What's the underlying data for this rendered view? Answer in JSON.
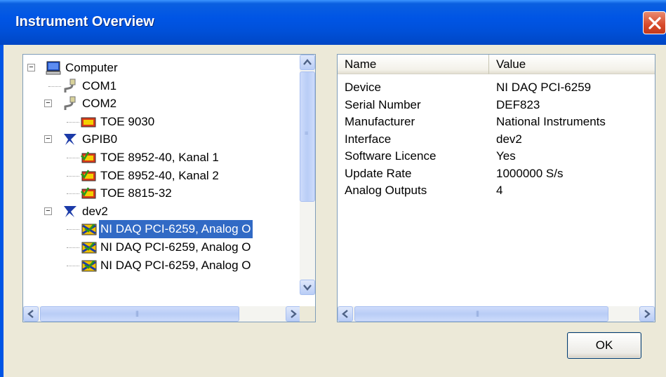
{
  "window": {
    "title": "Instrument Overview"
  },
  "tree": {
    "nodes": [
      {
        "label": "Computer",
        "icon": "computer-icon",
        "expander": "−"
      },
      {
        "label": "COM1",
        "icon": "serial-port-icon"
      },
      {
        "label": "COM2",
        "icon": "serial-port-icon",
        "expander": "−"
      },
      {
        "label": "TOE 9030",
        "icon": "toe-device-icon"
      },
      {
        "label": "GPIB0",
        "icon": "gpib-bus-icon",
        "expander": "−"
      },
      {
        "label": "TOE 8952-40, Kanal 1",
        "icon": "toe-device-check-icon"
      },
      {
        "label": "TOE 8952-40, Kanal 2",
        "icon": "toe-device-check-icon"
      },
      {
        "label": "TOE 8815-32",
        "icon": "toe-device-check-icon"
      },
      {
        "label": "dev2",
        "icon": "ni-device-icon",
        "expander": "−"
      },
      {
        "label": "NI DAQ PCI-6259, Analog O",
        "icon": "ni-daq-icon",
        "selected": true
      },
      {
        "label": "NI DAQ PCI-6259, Analog O",
        "icon": "ni-daq-icon"
      },
      {
        "label": "NI DAQ PCI-6259, Analog O",
        "icon": "ni-daq-icon"
      }
    ]
  },
  "properties": {
    "headers": {
      "name": "Name",
      "value": "Value"
    },
    "rows": [
      {
        "name": "Device",
        "value": "NI DAQ PCI-6259"
      },
      {
        "name": "Serial Number",
        "value": "DEF823"
      },
      {
        "name": "Manufacturer",
        "value": "National Instruments"
      },
      {
        "name": "Interface",
        "value": "dev2"
      },
      {
        "name": "Software Licence",
        "value": "Yes"
      },
      {
        "name": "Update Rate",
        "value": "1000000 S/s"
      },
      {
        "name": "Analog Outputs",
        "value": "4"
      }
    ]
  },
  "buttons": {
    "ok": "OK"
  }
}
